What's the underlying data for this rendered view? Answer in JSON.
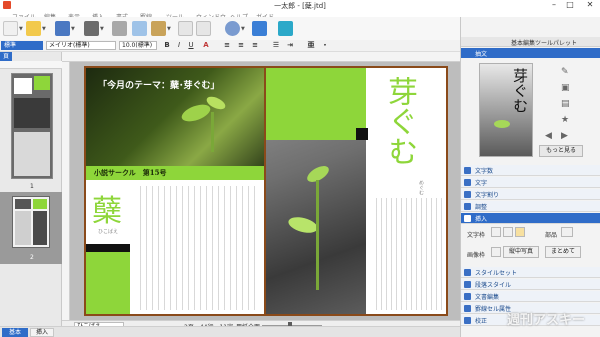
{
  "window": {
    "title": "一太郎 - [蘖.jtd]",
    "minimize_glyph": "–",
    "maximize_glyph": "□",
    "close_glyph": "✕"
  },
  "menu": {
    "items": [
      "ファイル",
      "編集",
      "表示",
      "挿入",
      "書式",
      "罫線",
      "ツール",
      "ウィンドウ",
      "ヘルプ",
      "ガイド"
    ]
  },
  "toolbar": {
    "mode_label": "文字",
    "mode_icon_letter": "A"
  },
  "formatbar": {
    "style_value": "標準",
    "font_value": "メイリオ(標準)",
    "size_value": "10.0(標準)",
    "bold": "B",
    "italic": "I",
    "underline": "U"
  },
  "leftpanel": {
    "tab_label": "頁",
    "page_numbers": [
      "1",
      "2"
    ]
  },
  "document": {
    "theme_label": "「今月のテーマ：蘖･芽ぐむ」",
    "club_label": "小説サークル　第15号",
    "kanji_title": "蘖",
    "kanji_reading": "ひこばえ",
    "right_title": "芽ぐむ",
    "right_reading": "めぐむ"
  },
  "statusbar": {
    "label": "ひこばえ",
    "position": "2頁　44行　11字",
    "mode": "用紙全面"
  },
  "bottomtabs": {
    "tab1": "基本",
    "tab2": "挿入"
  },
  "rightpanel": {
    "header_label": "基本編集ツールパレット",
    "section_label": "抽文",
    "preview_title": "芽ぐむ",
    "more_label": "もっと見る",
    "rows": [
      {
        "label": "文字数",
        "color": "#3a6fc4"
      },
      {
        "label": "文字",
        "color": "#3a6fc4"
      },
      {
        "label": "文字割り",
        "color": "#3a6fc4"
      },
      {
        "label": "調整",
        "color": "#3a6fc4"
      },
      {
        "label": "挿入",
        "color": "#3a6fc4"
      }
    ],
    "insert_row1_label": "文字枠",
    "insert_row1_right": "部品",
    "insert_row2_label": "画像枠",
    "insert_photo": "縦中写真",
    "insert_together": "まとめて",
    "rows_bottom": [
      {
        "label": "スタイルセット",
        "color": "#3a6fc4"
      },
      {
        "label": "段落スタイル",
        "color": "#3a6fc4"
      },
      {
        "label": "文書編集",
        "color": "#3a6fc4"
      },
      {
        "label": "罫線セル属性",
        "color": "#3a6fc4"
      },
      {
        "label": "校正",
        "color": "#3a6fc4"
      }
    ],
    "watermark": "週刊アスキー"
  },
  "colors": {
    "accent_green": "#8ed63a",
    "dark_green": "#3f5a1a",
    "brown_border": "#8a4a1a",
    "panel_blue": "#3a6fc4"
  }
}
